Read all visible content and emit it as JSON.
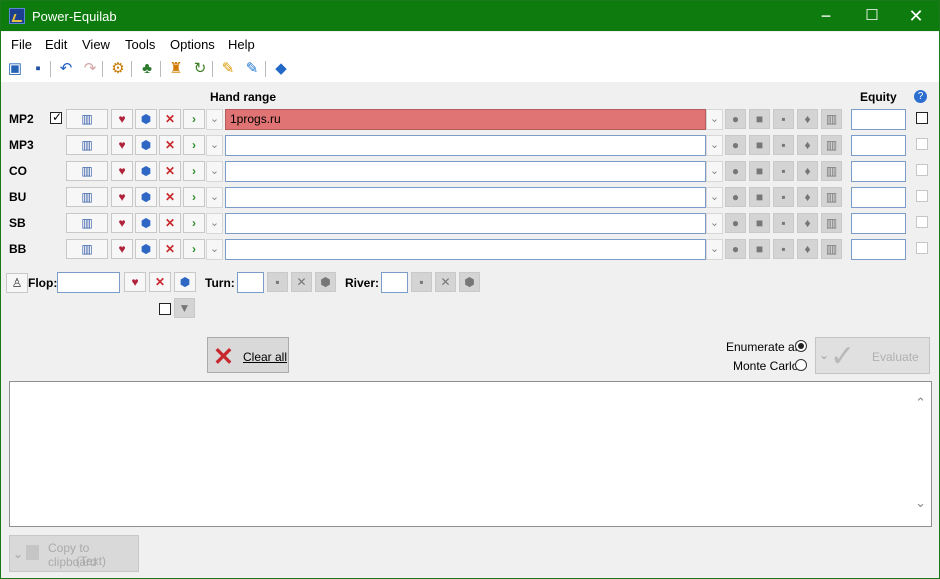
{
  "window": {
    "title": "Power-Equilab",
    "buttons": [
      "−",
      "☐",
      "✕"
    ]
  },
  "menu": [
    "File",
    "Edit",
    "View",
    "Tools",
    "Options",
    "Help"
  ],
  "toolbar": {
    "icons": [
      "open-folder-icon",
      "save-icon",
      "undo-icon",
      "redo-icon",
      "gear-icon",
      "tree-icon",
      "bucket-icon",
      "refresh-icon",
      "pencil-icon",
      "pen-icon",
      "book-icon"
    ]
  },
  "headers": {
    "hand_range": "Hand range",
    "equity": "Equity",
    "help": "?"
  },
  "players": [
    {
      "label": "MP2",
      "checked": true,
      "range": "1progs.ru",
      "equity": ""
    },
    {
      "label": "MP3",
      "checked": false,
      "range": "",
      "equity": ""
    },
    {
      "label": "CO",
      "checked": false,
      "range": "",
      "equity": ""
    },
    {
      "label": "BU",
      "checked": false,
      "range": "",
      "equity": ""
    },
    {
      "label": "SB",
      "checked": false,
      "range": "",
      "equity": ""
    },
    {
      "label": "BB",
      "checked": false,
      "range": "",
      "equity": ""
    }
  ],
  "board": {
    "flop_label": "Flop:",
    "turn_label": "Turn:",
    "river_label": "River:",
    "flop_value": "",
    "turn_value": "",
    "river_value": ""
  },
  "controls": {
    "clear_all": "Clear all",
    "enumerate_all": "Enumerate all",
    "monte_carlo": "Monte Carlo",
    "evaluate": "Evaluate",
    "copy_clipboard_1": "Copy to clipboard",
    "copy_clipboard_2": "(Text)"
  },
  "colors": {
    "titlebar": "#0d7b0d",
    "selected_range": "#e07373"
  }
}
